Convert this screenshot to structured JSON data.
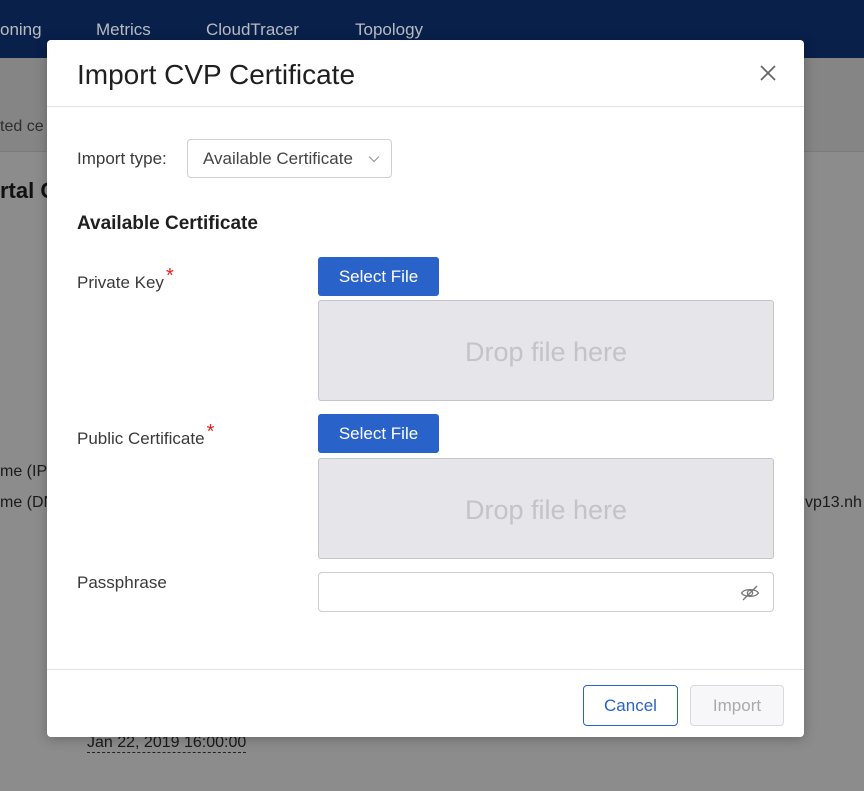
{
  "background": {
    "nav_items": [
      "oning",
      "Metrics",
      "CloudTracer",
      "Topology"
    ],
    "subbar_text": "ted ce",
    "section_heading": "rtal C",
    "field_ip": "me (IP)",
    "field_dns": "me (DN",
    "dns_value_fragment": "vp13.nh",
    "date_value": "Jan 22, 2019 16:00:00"
  },
  "modal": {
    "title": "Import CVP Certificate",
    "import_type_label": "Import type:",
    "import_type_value": "Available Certificate",
    "section_title": "Available Certificate",
    "private_key_label": "Private Key",
    "public_cert_label": "Public Certificate",
    "required_marker": "*",
    "select_file_label": "Select File",
    "drop_text": "Drop file here",
    "passphrase_label": "Passphrase",
    "passphrase_value": "",
    "cancel_label": "Cancel",
    "import_label": "Import"
  },
  "colors": {
    "accent": "#2962c8",
    "required": "#e0221f",
    "nav_bg": "#08204a"
  }
}
